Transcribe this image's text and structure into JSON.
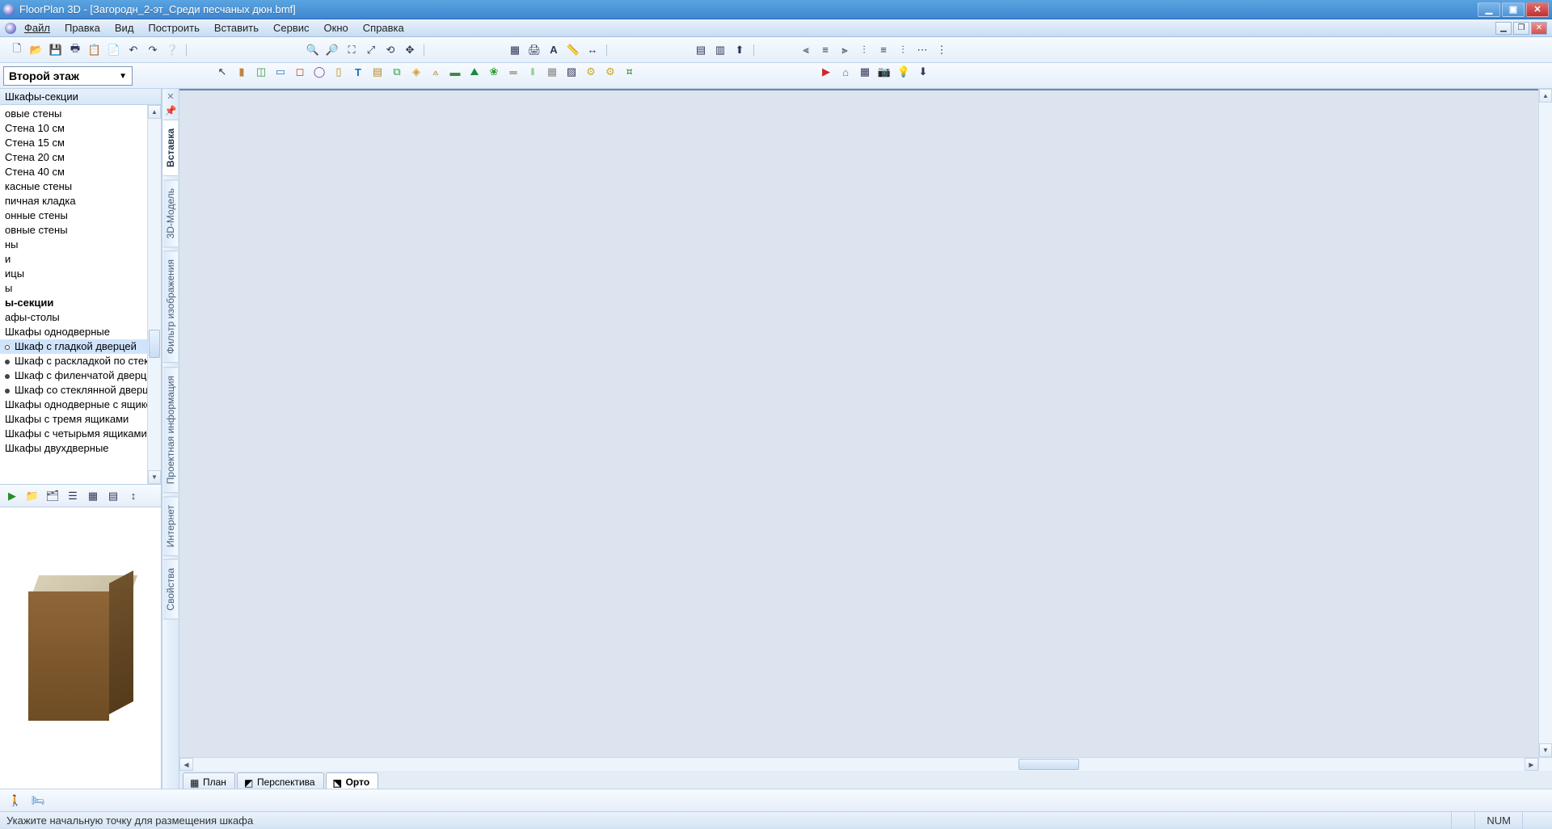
{
  "app": {
    "title": "FloorPlan 3D - [Загородн_2-эт_Среди песчаных дюн.bmf]"
  },
  "menu": {
    "file": "Файл",
    "edit": "Правка",
    "view": "Вид",
    "build": "Построить",
    "insert": "Вставить",
    "service": "Сервис",
    "window": "Окно",
    "help": "Справка"
  },
  "floor_selector": {
    "value": "Второй этаж"
  },
  "side_panel": {
    "title": "Шкафы-секции",
    "items": [
      {
        "bold": false,
        "text": ""
      },
      {
        "bold": false,
        "text": "овые стены"
      },
      {
        "bold": false,
        "text": "Стена 10 см"
      },
      {
        "bold": false,
        "text": "Стена 15 см"
      },
      {
        "bold": false,
        "text": "Стена 20 см"
      },
      {
        "bold": false,
        "text": "Стена 40 см"
      },
      {
        "bold": false,
        "text": "касные стены"
      },
      {
        "bold": false,
        "text": "пичная кладка"
      },
      {
        "bold": false,
        "text": "онные стены"
      },
      {
        "bold": false,
        "text": "овные стены"
      },
      {
        "bold": false,
        "text": "ны"
      },
      {
        "bold": false,
        "text": "и"
      },
      {
        "bold": false,
        "text": "ицы"
      },
      {
        "bold": false,
        "text": "ы"
      },
      {
        "bold": true,
        "text": "ы-секции"
      },
      {
        "bold": false,
        "text": "афы-столы"
      },
      {
        "bold": false,
        "text": "Шкафы однодверные"
      },
      {
        "bold": false,
        "text": "Шкаф с гладкой дверцей",
        "sub": true,
        "open": true,
        "sel": true
      },
      {
        "bold": false,
        "text": "Шкаф с раскладкой по стеклу",
        "sub": true
      },
      {
        "bold": false,
        "text": "Шкаф с филенчатой дверцей",
        "sub": true
      },
      {
        "bold": false,
        "text": "Шкаф со стеклянной дверцей",
        "sub": true
      },
      {
        "bold": false,
        "text": "Шкафы однодверные с ящиком"
      },
      {
        "bold": false,
        "text": "Шкафы с тремя ящиками"
      },
      {
        "bold": false,
        "text": "Шкафы с четырьмя ящиками"
      },
      {
        "bold": false,
        "text": "Шкафы двухдверные"
      }
    ]
  },
  "vertical_tabs": {
    "insert": "Вставка",
    "model3d": "3D-Модель",
    "imagefilter": "Фильтр изображения",
    "projectinfo": "Проектная информация",
    "internet": "Интернет",
    "properties": "Свойства"
  },
  "view_tabs": {
    "plan": "План",
    "perspective": "Перспектива",
    "ortho": "Орто"
  },
  "status": {
    "hint": "Укажите начальную точку для размещения шкафа",
    "num": "NUM"
  },
  "colors": {
    "roof": "#3a4858",
    "wall": "#d9caa8",
    "wall_shadow": "#c6b896",
    "trim": "#ffffff",
    "terrace": "#d6e2ec",
    "brick": "#b08268",
    "rail": "#3a3a3a",
    "driveway": "#bcbcbc"
  }
}
